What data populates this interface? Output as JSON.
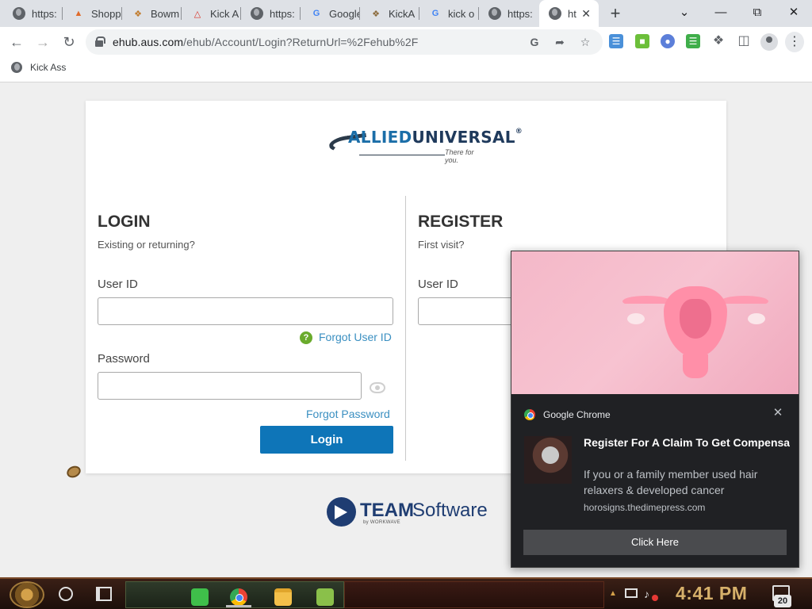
{
  "browser": {
    "tabs": [
      {
        "title": "https:",
        "icon": "globe-icon"
      },
      {
        "title": "Shopp",
        "icon": "shopping-icon"
      },
      {
        "title": "Bowm",
        "icon": "bowmans-icon"
      },
      {
        "title": "Kick A",
        "icon": "warning-triangle-icon"
      },
      {
        "title": "https:",
        "icon": "globe-icon"
      },
      {
        "title": "Google",
        "icon": "google-icon"
      },
      {
        "title": "KickA",
        "icon": "extension-icon"
      },
      {
        "title": "kick o",
        "icon": "google-icon"
      },
      {
        "title": "https:",
        "icon": "globe-icon"
      },
      {
        "title": "ht",
        "icon": "globe-icon",
        "active": true
      }
    ],
    "address_bar": {
      "url_host": "ehub.aus.com",
      "url_path": "/ehub/Account/Login?ReturnUrl=%2Fehub%2F"
    },
    "bookmarks": [
      {
        "label": "Kick Ass",
        "icon": "globe-icon"
      }
    ]
  },
  "page": {
    "logo": {
      "brand_part1": "ALLIED",
      "brand_part2": "UNIVERSAL",
      "trademark": "®",
      "tagline": "There for you."
    },
    "login": {
      "title": "LOGIN",
      "subtitle": "Existing or returning?",
      "user_id_label": "User ID",
      "user_id_value": "",
      "forgot_user_id": "Forgot User ID",
      "password_label": "Password",
      "password_value": "",
      "forgot_password": "Forgot Password",
      "submit_label": "Login"
    },
    "register": {
      "title": "REGISTER",
      "subtitle": "First visit?",
      "user_id_label": "User ID",
      "user_id_value": ""
    },
    "footer_logo": {
      "team": "TEAM",
      "software": "Software",
      "by_line": "by WORKWAVE"
    }
  },
  "notification": {
    "source": "Google Chrome",
    "title": "Register For A Claim To Get Compensated For Hair Relaxer Injuries",
    "body": "If you or a family member used hair relaxers & developed cancer",
    "domain": "horosigns.thedimepress.com",
    "button_label": "Click Here"
  },
  "taskbar": {
    "clock": "4:41 PM",
    "notification_count": "20"
  },
  "colors": {
    "login_button": "#0e75b8",
    "link": "#3a8fc1",
    "notification_bg": "#202124"
  }
}
